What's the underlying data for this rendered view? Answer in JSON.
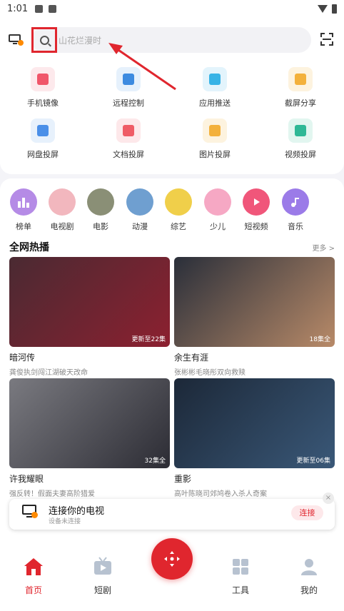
{
  "status_bar": {
    "time": "1:01"
  },
  "header": {
    "search_placeholder": "山花烂漫时"
  },
  "features": [
    {
      "label": "手机镜像",
      "icon": "phone-mirror-icon",
      "bg": "#fde9ec",
      "fg": "#f0566a"
    },
    {
      "label": "远程控制",
      "icon": "remote-control-icon",
      "bg": "#e6f1fc",
      "fg": "#3d8be0"
    },
    {
      "label": "应用推送",
      "icon": "app-push-icon",
      "bg": "#e3f4fc",
      "fg": "#37b3e6"
    },
    {
      "label": "截屏分享",
      "icon": "screenshot-share-icon",
      "bg": "#fdf3df",
      "fg": "#f3b13c"
    },
    {
      "label": "网盘投屏",
      "icon": "cloud-cast-icon",
      "bg": "#e7f1fc",
      "fg": "#4a8fe8"
    },
    {
      "label": "文档投屏",
      "icon": "document-cast-icon",
      "bg": "#fde8ea",
      "fg": "#ef5c66"
    },
    {
      "label": "图片投屏",
      "icon": "image-cast-icon",
      "bg": "#fdf3df",
      "fg": "#f3b13c"
    },
    {
      "label": "视频投屏",
      "icon": "video-cast-icon",
      "bg": "#e2f6f0",
      "fg": "#2fb896"
    }
  ],
  "categories": [
    {
      "label": "榜单",
      "icon": "ranking-icon",
      "color": "#b58be6"
    },
    {
      "label": "电视剧",
      "icon": "tv-drama-avatar",
      "color": "#f2b7be"
    },
    {
      "label": "电影",
      "icon": "movie-avatar",
      "color": "#8a8f76"
    },
    {
      "label": "动漫",
      "icon": "anime-avatar",
      "color": "#6f9fd0"
    },
    {
      "label": "综艺",
      "icon": "variety-avatar",
      "color": "#f0cf4a"
    },
    {
      "label": "少儿",
      "icon": "kids-avatar",
      "color": "#f6a8c4"
    },
    {
      "label": "短视频",
      "icon": "short-video-icon",
      "color": "#f0567a"
    },
    {
      "label": "音乐",
      "icon": "music-icon",
      "color": "#9b7be8"
    }
  ],
  "section": {
    "title": "全网热播",
    "more": "更多 >"
  },
  "videos": [
    {
      "title": "暗河传",
      "subtitle": "龚俊执剑闯江湖破天改命",
      "badge": "更新至22集",
      "color1": "#4a2a32",
      "color2": "#8c2030"
    },
    {
      "title": "余生有涯",
      "subtitle": "张彬彬毛晓彤双向救赎",
      "badge": "18集全",
      "color1": "#2a2f3a",
      "color2": "#b88a68"
    },
    {
      "title": "许我耀眼",
      "subtitle": "强反转！假面夫妻高阶猎爱",
      "badge": "32集全",
      "color1": "#7a7a80",
      "color2": "#2c2c34"
    },
    {
      "title": "重影",
      "subtitle": "高叶陈晓司郊鸠卷入杀人奇案",
      "badge": "更新至06集",
      "color1": "#1c2838",
      "color2": "#3a5878"
    }
  ],
  "tv_popup": {
    "title": "连接你的电视",
    "subtitle": "设备未连接",
    "connect": "连接",
    "close": "×"
  },
  "nav": [
    {
      "label": "首页",
      "icon": "home-icon",
      "active": true
    },
    {
      "label": "短剧",
      "icon": "short-drama-icon",
      "active": false
    },
    {
      "label": "工具",
      "icon": "tools-icon",
      "active": false
    },
    {
      "label": "我的",
      "icon": "profile-icon",
      "active": false
    }
  ],
  "colors": {
    "accent": "#e0262e",
    "annotation": "#e0262e"
  }
}
